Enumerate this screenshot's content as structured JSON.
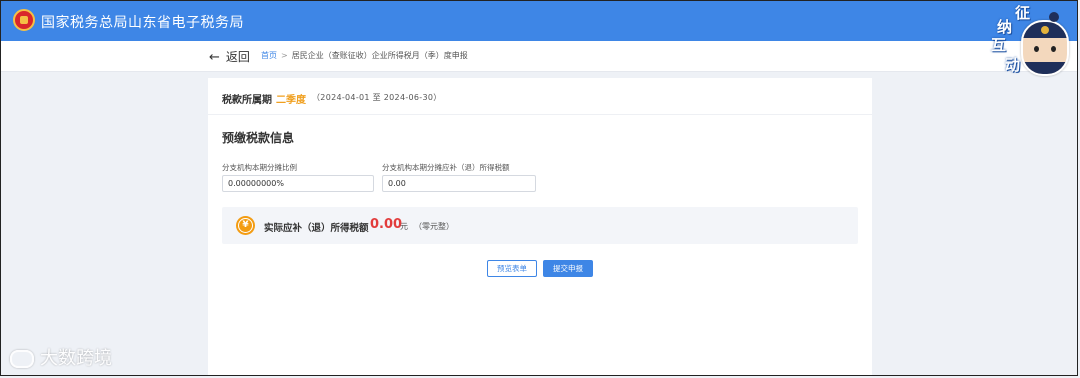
{
  "header": {
    "site_title": "国家税务总局山东省电子税务局"
  },
  "nav": {
    "back_label": "返回",
    "breadcrumb": {
      "home": "首页",
      "separator": ">",
      "current": "居民企业（查账征收）企业所得税月（季）度申报"
    }
  },
  "badge": {
    "chars": [
      "征",
      "纳",
      "互",
      "动"
    ]
  },
  "period": {
    "label": "税款所属期",
    "quarter": "二季度",
    "range": "（2024-04-01 至 2024-06-30）"
  },
  "section": {
    "title": "预缴税款信息"
  },
  "fields": [
    {
      "label": "分支机构本期分摊比例",
      "value": "0.00000000%"
    },
    {
      "label": "分支机构本期分摊应补（退）所得税额",
      "value": "0.00"
    }
  ],
  "result": {
    "coin_symbol": "¥",
    "label": "实际应补（退）所得税额",
    "value": "0.00",
    "unit": "元",
    "note": "（零元整）"
  },
  "buttons": {
    "preview": "预览表单",
    "submit": "提交申报"
  },
  "watermark": {
    "text": "大数跨境"
  },
  "colors": {
    "primary": "#3e86e6",
    "accent": "#f0a020",
    "amount": "#e23c3c"
  }
}
